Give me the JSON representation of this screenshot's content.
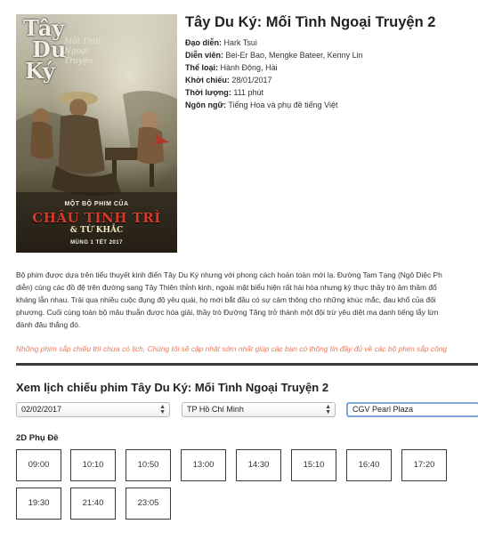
{
  "poster": {
    "title_line1": "Tây",
    "title_line2": "Du",
    "title_line3": "Ký",
    "subtitle": "Mối Tình Ngoại Truyện",
    "credit_line1": "MỘT BỘ PHIM CỦA",
    "credit_line2": "CHÂU TINH TRÌ",
    "credit_line3": "& TỪ KHẮC",
    "release_line": "MÙNG 1 TẾT 2017"
  },
  "movie": {
    "title": "Tây Du Ký: Mối Tình Ngoại Truyện 2",
    "details": [
      {
        "label": "Đạo diễn:",
        "value": "Hark Tsui"
      },
      {
        "label": "Diễn viên:",
        "value": "Bei-Er Bao, Mengke Bateer, Kenny Lin"
      },
      {
        "label": "Thể loại:",
        "value": "Hành Động, Hài"
      },
      {
        "label": "Khởi chiếu:",
        "value": "28/01/2017"
      },
      {
        "label": "Thời lượng:",
        "value": "111 phút"
      },
      {
        "label": "Ngôn ngữ:",
        "value": "Tiếng Hoa và phụ đề tiếng Việt"
      }
    ],
    "description_lines": [
      "Bộ phim được dựa trên tiểu thuyết kinh điển Tây Du Ký nhưng với phong cách hoàn toàn mới lạ. Đường Tam Tạng (Ngô Diệc Ph",
      "diễn) cùng các đồ đệ trên đường sang Tây Thiên thỉnh kinh, ngoài mặt biểu hiện rất hài hòa nhưng kỳ thực thầy trò âm thầm đổ",
      "kháng lẫn nhau. Trải qua nhiều cuộc đụng độ yêu quái, họ mới bắt đầu có sự cảm thông cho những khúc mắc, đau khổ của đối",
      "phương. Cuối cùng toàn bộ mâu thuẫn được hóa giải, thầy trò Đường Tăng trở thành một đội trừ yêu diệt ma danh tiếng lẫy lừn",
      "đánh đâu thắng đó."
    ],
    "notice": "Những phim sắp chiếu thì chưa có lịch. Chúng tôi sẽ cập nhật sớm nhất giúp các bạn có thông tin đầy đủ về các bộ phim sắp công"
  },
  "schedule": {
    "heading": "Xem lịch chiếu phim Tây Du Ký: Mối Tình Ngoại Truyện 2",
    "date_select": "02/02/2017",
    "city_select": "TP Hồ Chí Minh",
    "cinema_select": "CGV Pearl Plaza",
    "format": "2D Phụ Đề",
    "times": [
      "09:00",
      "10:10",
      "10:50",
      "13:00",
      "14:30",
      "15:10",
      "16:40",
      "17:20",
      "19:30",
      "21:40",
      "23:05"
    ]
  }
}
